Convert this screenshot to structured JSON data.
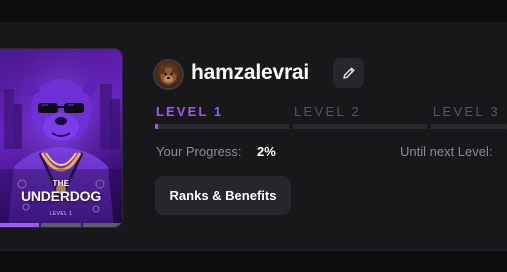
{
  "profile": {
    "username": "hamzalevrai",
    "avatar_icon": "dog-avatar-icon",
    "edit_icon": "pencil-icon"
  },
  "rank_card": {
    "prefix": "THE",
    "name": "UNDERDOG",
    "level": "LEVEL 1",
    "progress_segments_active": 1,
    "progress_segments_total": 3
  },
  "levels": [
    {
      "label": "LEVEL 1",
      "active": true,
      "progress": 0.02
    },
    {
      "label": "LEVEL 2",
      "active": false,
      "progress": 0
    },
    {
      "label": "LEVEL 3",
      "active": false,
      "progress": 0
    }
  ],
  "progress": {
    "label": "Your Progress:",
    "value": "2%",
    "next_level_label": "Until next Level:"
  },
  "buttons": {
    "ranks_benefits": "Ranks & Benefits"
  },
  "colors": {
    "accent": "#9b5cf6",
    "panel": "#18181b",
    "button": "#26262b",
    "muted_text": "#8b8b93"
  }
}
